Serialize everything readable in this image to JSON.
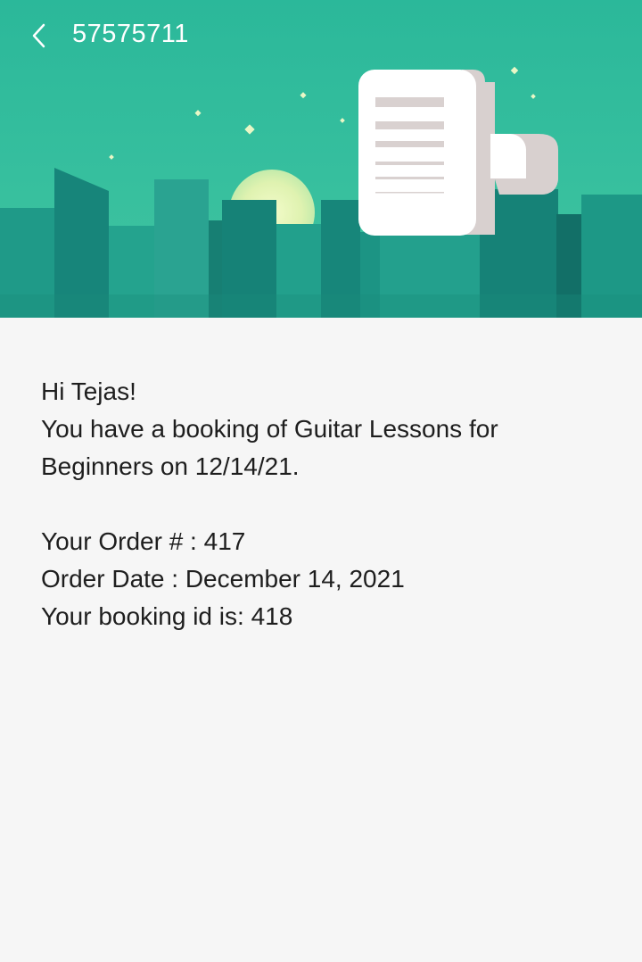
{
  "header": {
    "title": "57575711",
    "colors": {
      "bg": "#2bb89a",
      "buildings_dark": "#17857a",
      "buildings_mid": "#1f9a88",
      "sun": "#e8f5b8"
    }
  },
  "message": {
    "greeting": "Hi Tejas!",
    "booking_line1": "You have a booking of Guitar Lessons for",
    "booking_line2": "Beginners on 12/14/21.",
    "order_number": "Your Order # : 417",
    "order_date": "Order Date : December 14, 2021",
    "booking_id": "Your booking id is: 418"
  },
  "icons": {
    "back": "chevron-left-icon",
    "illustration": "receipt-scroll-icon"
  }
}
